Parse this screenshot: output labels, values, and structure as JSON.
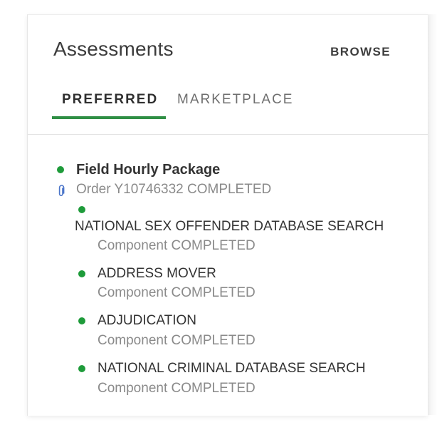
{
  "header": {
    "title": "Assessments",
    "browse_label": "BROWSE"
  },
  "tabs": [
    {
      "label": "PREFERRED",
      "active": true
    },
    {
      "label": "MARKETPLACE",
      "active": false
    }
  ],
  "package": {
    "name": "Field Hourly Package",
    "order_text": "Order Y10746332 COMPLETED",
    "status_color": "#1e9b3a"
  },
  "components": [
    {
      "name": "NATIONAL SEX OFFENDER DATABASE SEARCH",
      "status": "Component COMPLETED"
    },
    {
      "name": "ADDRESS MOVER",
      "status": "Component COMPLETED"
    },
    {
      "name": "ADJUDICATION",
      "status": "Component COMPLETED"
    },
    {
      "name": "NATIONAL CRIMINAL DATABASE SEARCH",
      "status": "Component COMPLETED"
    }
  ],
  "colors": {
    "accent": "#2f8f45",
    "status_dot": "#1e9b3a",
    "attachment_icon": "#4a74c9"
  },
  "icons": {
    "attachment": "paperclip-icon",
    "status": "status-dot-icon"
  }
}
